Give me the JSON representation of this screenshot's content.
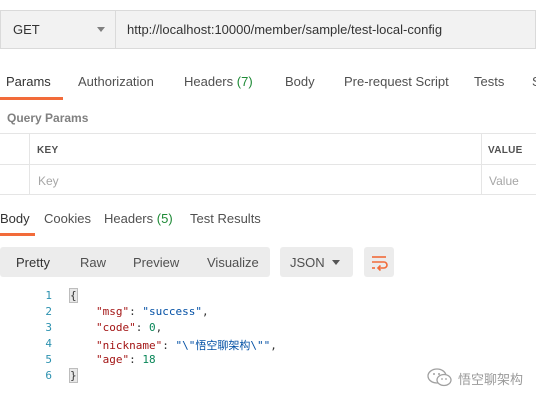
{
  "request": {
    "method": "GET",
    "url": "http://localhost:10000/member/sample/test-local-config"
  },
  "request_tabs": [
    {
      "label": "Params"
    },
    {
      "label": "Authorization"
    },
    {
      "label": "Headers",
      "count": "(7)"
    },
    {
      "label": "Body"
    },
    {
      "label": "Pre-request Script"
    },
    {
      "label": "Tests"
    },
    {
      "label": "S"
    }
  ],
  "query_params": {
    "title": "Query Params",
    "columns": [
      "KEY",
      "VALUE"
    ],
    "placeholders": [
      "Key",
      "Value"
    ]
  },
  "response_tabs": [
    {
      "label": "Body"
    },
    {
      "label": "Cookies"
    },
    {
      "label": "Headers",
      "count": "(5)"
    },
    {
      "label": "Test Results"
    }
  ],
  "view_modes": [
    "Pretty",
    "Raw",
    "Preview",
    "Visualize"
  ],
  "format": "JSON",
  "code": {
    "line_numbers": [
      "1",
      "2",
      "3",
      "4",
      "5",
      "6"
    ],
    "open_brace": "{",
    "close_brace": "}",
    "fields": [
      {
        "key": "\"msg\"",
        "sep": ": ",
        "value": "\"success\"",
        "end": ","
      },
      {
        "key": "\"code\"",
        "sep": ": ",
        "value": "0",
        "end": ","
      },
      {
        "key": "\"nickname\"",
        "sep": ": ",
        "value": "\"\\\"悟空聊架构\\\"\"",
        "end": ","
      },
      {
        "key": "\"age\"",
        "sep": ": ",
        "value": "18",
        "end": ""
      }
    ]
  },
  "watermark": "悟空聊架构",
  "colors": {
    "accent": "#f26b3a",
    "count_green": "#1e8a36",
    "json_key": "#a31515",
    "json_string": "#0451a5",
    "json_number": "#098658",
    "line_number": "#2b91af"
  }
}
